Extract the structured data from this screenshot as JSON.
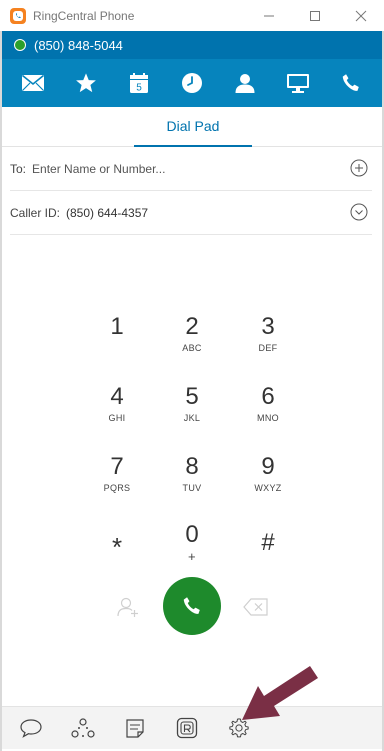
{
  "window": {
    "title": "RingCentral Phone",
    "minimize_glyph": "—",
    "maximize_glyph": "☐",
    "close_glyph": "✕"
  },
  "status": {
    "phone_number": "(850) 848-5044",
    "presence_color": "#2ca02c"
  },
  "nav": {
    "items": [
      {
        "icon": "envelope-icon"
      },
      {
        "icon": "star-icon"
      },
      {
        "icon": "calendar-icon",
        "badge": "5"
      },
      {
        "icon": "clock-icon"
      },
      {
        "icon": "contact-icon"
      },
      {
        "icon": "monitor-icon"
      },
      {
        "icon": "phone-icon"
      }
    ]
  },
  "tabs": {
    "dial_pad": "Dial Pad"
  },
  "to_field": {
    "label": "To:",
    "placeholder": "Enter Name or Number...",
    "value": ""
  },
  "caller_id": {
    "label": "Caller ID:",
    "value": "(850) 644-4357"
  },
  "keypad": {
    "keys": [
      {
        "digit": "1",
        "letters": ""
      },
      {
        "digit": "2",
        "letters": "ABC"
      },
      {
        "digit": "3",
        "letters": "DEF"
      },
      {
        "digit": "4",
        "letters": "GHI"
      },
      {
        "digit": "5",
        "letters": "JKL"
      },
      {
        "digit": "6",
        "letters": "MNO"
      },
      {
        "digit": "7",
        "letters": "PQRS"
      },
      {
        "digit": "8",
        "letters": "TUV"
      },
      {
        "digit": "9",
        "letters": "WXYZ"
      },
      {
        "digit": "*",
        "letters": ""
      },
      {
        "digit": "0",
        "letters": "+"
      },
      {
        "digit": "#",
        "letters": ""
      }
    ]
  },
  "colors": {
    "brand_blue": "#0684bd",
    "status_blue": "#0073ae",
    "call_green": "#1e8a2c",
    "annotation_arrow": "#7a2f45"
  },
  "bottom": {
    "items": [
      {
        "icon": "chat-bubble-icon"
      },
      {
        "icon": "glip-dots-icon"
      },
      {
        "icon": "notepad-icon"
      },
      {
        "icon": "ringcentral-app-icon"
      },
      {
        "icon": "settings-gear-icon"
      }
    ]
  }
}
